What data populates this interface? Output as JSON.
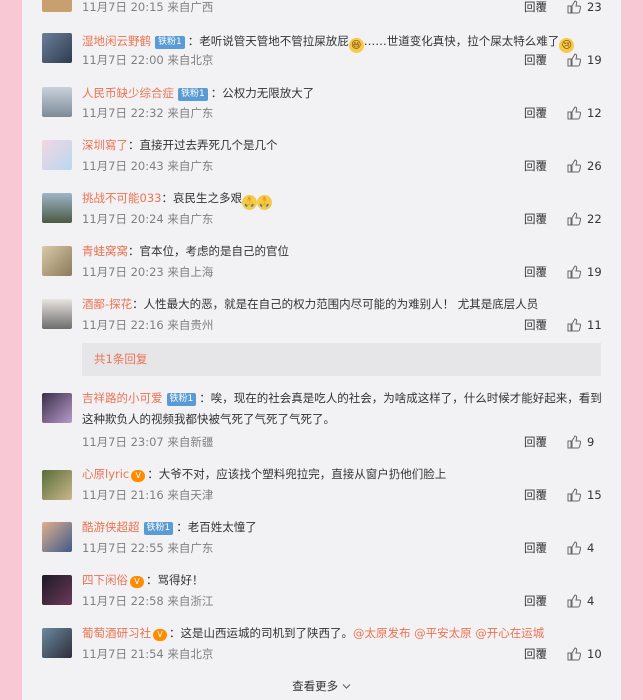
{
  "comments": [
    {
      "name": "",
      "text": "",
      "time": "11月7日 20:15 来自广西",
      "reply": "回覆",
      "likes": "23"
    },
    {
      "name": "湿地闲云野鹤",
      "badge": "铁粉1",
      "text": "老听说管天管地不管拉屎放屁",
      "text2": "……世道变化真快，拉个屎太特么难了",
      "time": "11月7日 22:00 来自北京",
      "reply": "回覆",
      "likes": "19"
    },
    {
      "name": "人民币缺少综合症",
      "badge": "铁粉1",
      "text": "公权力无限放大了",
      "time": "11月7日 22:32 来自广东",
      "reply": "回覆",
      "likes": "12"
    },
    {
      "name": "深圳寫了",
      "text": "直接开过去弄死几个是几个",
      "time": "11月7日 20:43 来自广东",
      "reply": "回覆",
      "likes": "26"
    },
    {
      "name": "挑战不可能033",
      "text": "哀民生之多艰",
      "time": "11月7日 20:24 来自广东",
      "reply": "回覆",
      "likes": "22"
    },
    {
      "name": "青蛙窝窝",
      "text": "官本位，考虑的是自己的官位",
      "time": "11月7日 20:23 来自上海",
      "reply": "回覆",
      "likes": "19"
    },
    {
      "name": "酒鄙-探花",
      "text": "人性最大的恶，就是在自己的权力范围内尽可能的为难别人！ 尤其是底层人员",
      "time": "11月7日 22:16 来自贵州",
      "reply": "回覆",
      "likes": "11",
      "replies": "共1条回复"
    },
    {
      "name": "吉祥路的小可爱",
      "badge": "铁粉1",
      "text": "唉，现在的社会真是吃人的社会，为啥成这样了，什么时候才能好起来，看到这种欺负人的视频我都快被气死了气死了气死了。",
      "time": "11月7日 23:07 来自新疆",
      "reply": "回覆",
      "likes": "9"
    },
    {
      "name": "心原lyric",
      "text": "大爷不对，应该找个塑料兜拉完，直接从窗户扔他们脸上",
      "time": "11月7日 21:16 来自天津",
      "reply": "回覆",
      "likes": "15"
    },
    {
      "name": "酷游侠超超",
      "badge": "铁粉1",
      "text": "老百姓太憧了",
      "time": "11月7日 22:55 来自广东",
      "reply": "回覆",
      "likes": "4"
    },
    {
      "name": "四下闲俗",
      "text": "骂得好！",
      "time": "11月7日 22:58 来自浙江",
      "reply": "回覆",
      "likes": "4"
    },
    {
      "name": "葡萄酒研习社",
      "text": "这是山西运城的司机到了陕西了。",
      "mentions": "@太原发布 @平安太原 @开心在运城",
      "time": "11月7日 21:54 来自北京",
      "reply": "回覆",
      "likes": "10"
    }
  ],
  "load_more": "查看更多",
  "colors": {
    "accent": "#eb7350",
    "badge": "#5b9bd5",
    "panel": "#f2f2f5",
    "page": "#f8c8d4"
  }
}
